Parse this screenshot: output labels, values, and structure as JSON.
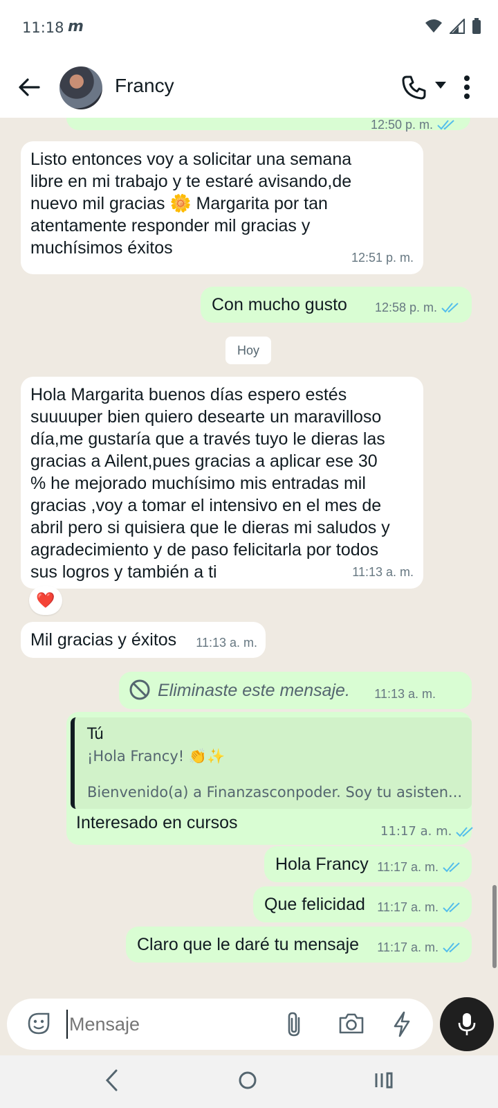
{
  "status_bar": {
    "time": "11:18",
    "app_glyph": "m"
  },
  "header": {
    "contact_name": "Francy"
  },
  "messages": {
    "partial_top": {
      "time": "12:50 p. m."
    },
    "m1": {
      "lines": [
        "Listo entonces voy a solicitar una semana",
        "libre en mi trabajo y te estaré avisando,de",
        "nuevo mil gracias 🌼 Margarita por tan",
        "atentamente responder mil gracias y",
        "muchísimos éxitos"
      ],
      "time": "12:51 p. m."
    },
    "m2": {
      "text": "Con mucho gusto",
      "time": "12:58 p. m."
    },
    "date_chip": "Hoy",
    "m3": {
      "lines": [
        "Hola Margarita buenos días espero estés",
        "suuuuper bien quiero desearte un maravilloso",
        "día,me gustaría que a través tuyo le dieras las",
        "gracias a Ailent,pues gracias a aplicar ese 30",
        "% he mejorado muchísimo mis entradas mil",
        "gracias ,voy a tomar el intensivo en el mes de",
        "abril pero si quisiera que le dieras mi saludos y",
        "agradecimiento y de paso felicitarla por todos",
        "sus logros y también a ti"
      ],
      "time": "11:13 a. m.",
      "reaction": "❤️"
    },
    "m4": {
      "text": "Mil gracias y éxitos",
      "time": "11:13 a. m."
    },
    "m5": {
      "text": "Eliminaste este mensaje.",
      "time": "11:13 a. m."
    },
    "m6": {
      "quote_author": "Tú",
      "quote_line1": "¡Hola Francy! 👏✨",
      "quote_line2": "Bienvenido(a) a Finanzasconpoder. Soy tu asisten...",
      "text": "Interesado en cursos",
      "time": "11:17 a. m."
    },
    "m7": {
      "text": "Hola Francy",
      "time": "11:17 a. m."
    },
    "m8": {
      "text": "Que felicidad",
      "time": "11:17 a. m."
    },
    "m9": {
      "text": "Claro que le daré tu mensaje",
      "time": "11:17 a. m."
    }
  },
  "composer": {
    "placeholder": "Mensaje"
  },
  "colors": {
    "incoming": "#ffffff",
    "outgoing": "#d9fdd3",
    "read_ticks": "#53bdeb",
    "background": "#efeae2"
  }
}
